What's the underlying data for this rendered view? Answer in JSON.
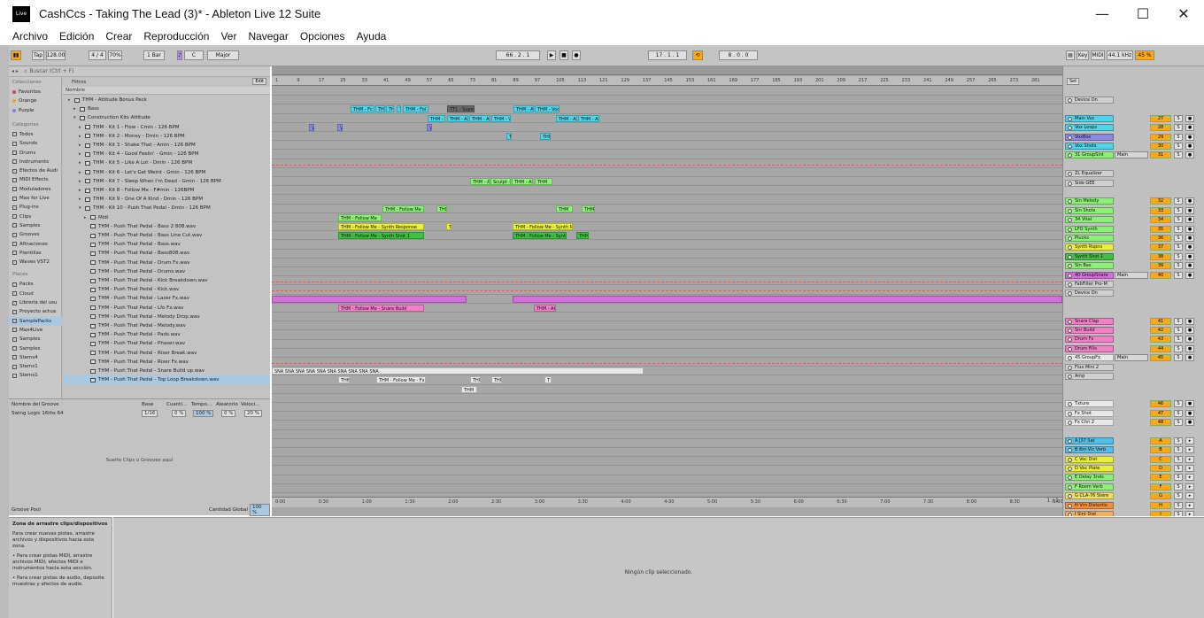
{
  "window": {
    "title": "CashCcs - Taking The Lead (3)* - Ableton Live 12 Suite",
    "logo": "Live",
    "controls": [
      "—",
      "☐",
      "✕"
    ]
  },
  "menu": [
    "Archivo",
    "Edición",
    "Crear",
    "Reproducción",
    "Ver",
    "Navegar",
    "Opciones",
    "Ayuda"
  ],
  "control_bar": {
    "tap": "Tap",
    "tempo": "128.00",
    "time_sig": "4 / 4",
    "swing": "70%",
    "quant": "1 Bar",
    "key": "C",
    "scale": "Major",
    "position": "66 .  2 .  1",
    "loop_start": "17 .  1 .  1",
    "loop_len": "8 .  0 .  0",
    "set_label": "Set",
    "key_label": "Key",
    "midi_label": "MIDI",
    "sample_rate": "44.1 kHz",
    "cpu": "45 %"
  },
  "browser": {
    "search_placeholder": "Buscar (Ctrl + F)",
    "filters_label": "Filtros",
    "edit_label": "Edit",
    "name_col": "Nombre",
    "sidebar": {
      "collections_header": "Colecciones",
      "collections": [
        {
          "label": "Favoritos",
          "color": "#e04040"
        },
        {
          "label": "Orange",
          "color": "#f0a030"
        },
        {
          "label": "Purple",
          "color": "#a070e0"
        }
      ],
      "categories_header": "Categorías",
      "categories": [
        "Todos",
        "Sounds",
        "Drums",
        "Instruments",
        "Efectos de Audi",
        "MIDI Effects",
        "Moduladores",
        "Max for Live",
        "Plug-ins",
        "Clips",
        "Samples",
        "Grooves",
        "Afinaciones",
        "Plantillas",
        "Waves VST2"
      ],
      "places_header": "Places",
      "places": [
        "Packs",
        "Cloud",
        "Librería del usu",
        "Proyecto actua",
        "SamplePacks",
        "Max4Live",
        "Samples",
        "Samples",
        "Stems4",
        "Stems1",
        "Stems1"
      ],
      "active_place": "SamplePacks"
    },
    "files": [
      {
        "label": "THM - Attitude Bonus Pack",
        "indent": 1,
        "type": "folder"
      },
      {
        "label": "Bass",
        "indent": 2,
        "type": "folder"
      },
      {
        "label": "Construction Kits Attitude",
        "indent": 2,
        "type": "folder",
        "open": true
      },
      {
        "label": "THM - Kit 1 - Flow - Cmin - 126 BPM",
        "indent": 3,
        "type": "folder"
      },
      {
        "label": "THM - Kit 2 - Money - Dmin - 126 BPM",
        "indent": 3,
        "type": "folder"
      },
      {
        "label": "THM - Kit 3 - Shake That - Amin - 126 BPM",
        "indent": 3,
        "type": "folder"
      },
      {
        "label": "THM - Kit 4 - Good Feelin' - Gmin - 126 BPM",
        "indent": 3,
        "type": "folder"
      },
      {
        "label": "THM - Kit 5 - Like A Lot - Dmin - 126 BPM",
        "indent": 3,
        "type": "folder"
      },
      {
        "label": "THM - Kit 6 - Let's Get Weird - Gmin - 126 BPM",
        "indent": 3,
        "type": "folder"
      },
      {
        "label": "THM - Kit 7 - Sleep When I'm Dead - Gmin - 126 BPM",
        "indent": 3,
        "type": "folder"
      },
      {
        "label": "THM - Kit 8 - Follow Me - F#min - 126BPM",
        "indent": 3,
        "type": "folder"
      },
      {
        "label": "THM - Kit 9 - One Of A Kind - Dmin - 126 BPM",
        "indent": 3,
        "type": "folder"
      },
      {
        "label": "THM - Kit 10 - Push That Pedal - Dmin - 126 BPM",
        "indent": 3,
        "type": "folder",
        "open": true
      },
      {
        "label": "Midi",
        "indent": 4,
        "type": "folder"
      },
      {
        "label": "THM - Push That Pedal - Bass 2 808.wav",
        "indent": 4,
        "type": "file"
      },
      {
        "label": "THM - Push That Pedal - Bass Line Cut.wav",
        "indent": 4,
        "type": "file"
      },
      {
        "label": "THM - Push That Pedal - Bass.wav",
        "indent": 4,
        "type": "file"
      },
      {
        "label": "THM - Push That Pedal - Bass808.wav",
        "indent": 4,
        "type": "file"
      },
      {
        "label": "THM - Push That Pedal - Drum Fx.wav",
        "indent": 4,
        "type": "file"
      },
      {
        "label": "THM - Push That Pedal - Drums.wav",
        "indent": 4,
        "type": "file"
      },
      {
        "label": "THM - Push That Pedal - Kick Breakdown.wav",
        "indent": 4,
        "type": "file"
      },
      {
        "label": "THM - Push That Pedal - Kick.wav",
        "indent": 4,
        "type": "file"
      },
      {
        "label": "THM - Push That Pedal - Lazer Fx.wav",
        "indent": 4,
        "type": "file"
      },
      {
        "label": "THM - Push That Pedal - Lfo Fx.wav",
        "indent": 4,
        "type": "file"
      },
      {
        "label": "THM - Push That Pedal - Melody Drop.wav",
        "indent": 4,
        "type": "file"
      },
      {
        "label": "THM - Push That Pedal - Melody.wav",
        "indent": 4,
        "type": "file"
      },
      {
        "label": "THM - Push That Pedal - Pads.wav",
        "indent": 4,
        "type": "file"
      },
      {
        "label": "THM - Push That Pedal - Phaser.wav",
        "indent": 4,
        "type": "file"
      },
      {
        "label": "THM - Push That Pedal - Riser Break.wav",
        "indent": 4,
        "type": "file"
      },
      {
        "label": "THM - Push That Pedal - Riser Fx.wav",
        "indent": 4,
        "type": "file"
      },
      {
        "label": "THM - Push That Pedal - Snare Build up.wav",
        "indent": 4,
        "type": "file"
      },
      {
        "label": "THM - Push That Pedal - Top Loop Breakdown.wav",
        "indent": 4,
        "type": "file",
        "selected": true
      }
    ]
  },
  "groove_pool": {
    "headers": [
      "Nombre del Groove",
      "Base",
      "Cuanti...",
      "Tempo...",
      "Aleatorio",
      "Veloci..."
    ],
    "row": {
      "name": "Swing Logic 16ths 64",
      "base": "1/16",
      "quant": "0 %",
      "timing": "100 %",
      "random": "0 %",
      "velocity": "20 %"
    },
    "hint": "Suelte Clips o Grooves aquí",
    "footer_title": "Groove Pool",
    "footer_amount_label": "Cantidad Global",
    "footer_amount": "100 %"
  },
  "ruler_ticks": [
    "1",
    "9",
    "17",
    "25",
    "33",
    "41",
    "49",
    "57",
    "65",
    "73",
    "81",
    "89",
    "97",
    "105",
    "113",
    "121",
    "129",
    "137",
    "145",
    "153",
    "161",
    "169",
    "177",
    "185",
    "193",
    "201",
    "209",
    "217",
    "225",
    "233",
    "241",
    "249",
    "257",
    "265",
    "273",
    "281"
  ],
  "time_ticks": [
    "0:00",
    "0:30",
    "1:00",
    "1:30",
    "2:00",
    "2:30",
    "3:00",
    "3:30",
    "4:00",
    "4:30",
    "5:00",
    "5:30",
    "6:00",
    "6:30",
    "7:00",
    "7:30",
    "8:00",
    "8:30",
    "9:00"
  ],
  "page_indicator": "1 / 1",
  "clips": [
    {
      "lane": 2,
      "start": 89,
      "end": 116,
      "label": "THM - Fc",
      "color": "#4fd4e8"
    },
    {
      "lane": 2,
      "start": 117,
      "end": 128,
      "label": "THM - C",
      "color": "#4fd4e8"
    },
    {
      "lane": 2,
      "start": 129,
      "end": 138,
      "label": "THM",
      "color": "#4fd4e8"
    },
    {
      "lane": 2,
      "start": 141,
      "end": 146,
      "label": "TH",
      "color": "#4fd4e8"
    },
    {
      "lane": 2,
      "start": 148,
      "end": 177,
      "label": "THM - Fol",
      "color": "#4fd4e8"
    },
    {
      "lane": 2,
      "start": 198,
      "end": 229,
      "label": "TT1 - Supe",
      "color": "#6a6a6a"
    },
    {
      "lane": 2,
      "start": 273,
      "end": 296,
      "label": "THM - Ab",
      "color": "#4fd4e8"
    },
    {
      "lane": 2,
      "start": 297,
      "end": 325,
      "label": "THM - Vocal",
      "color": "#4fd4e8"
    },
    {
      "lane": 3,
      "start": 176,
      "end": 196,
      "label": "THM - Ab",
      "color": "#4fd4e8"
    },
    {
      "lane": 3,
      "start": 198,
      "end": 222,
      "label": "THM - Ab",
      "color": "#4fd4e8"
    },
    {
      "lane": 3,
      "start": 223,
      "end": 247,
      "label": "THM - Ab",
      "color": "#4fd4e8"
    },
    {
      "lane": 3,
      "start": 248,
      "end": 270,
      "label": "THM - Vocal",
      "color": "#4fd4e8"
    },
    {
      "lane": 3,
      "start": 321,
      "end": 345,
      "label": "THM - Ab",
      "color": "#4fd4e8"
    },
    {
      "lane": 3,
      "start": 346,
      "end": 370,
      "label": "THM - Ab",
      "color": "#4fd4e8"
    },
    {
      "lane": 4,
      "start": 42,
      "end": 48,
      "label": "VS",
      "color": "#8a8ae0"
    },
    {
      "lane": 4,
      "start": 74,
      "end": 80,
      "label": "VS",
      "color": "#8a8ae0"
    },
    {
      "lane": 4,
      "start": 175,
      "end": 181,
      "label": "VO",
      "color": "#8a8ae0"
    },
    {
      "lane": 5,
      "start": 265,
      "end": 271,
      "label": "TH",
      "color": "#4fd4e8"
    },
    {
      "lane": 5,
      "start": 303,
      "end": 315,
      "label": "THM",
      "color": "#4fd4e8"
    },
    {
      "lane": 10,
      "start": 224,
      "end": 246,
      "label": "THM - At",
      "color": "#8ef07a"
    },
    {
      "lane": 10,
      "start": 247,
      "end": 270,
      "label": "Sculpt - 1",
      "color": "#8ef07a"
    },
    {
      "lane": 10,
      "start": 271,
      "end": 295,
      "label": "THM - At",
      "color": "#8ef07a"
    },
    {
      "lane": 10,
      "start": 297,
      "end": 317,
      "label": "THM",
      "color": "#8ef07a"
    },
    {
      "lane": 13,
      "start": 125,
      "end": 172,
      "label": "THM - Follow Me",
      "color": "#8ef07a"
    },
    {
      "lane": 13,
      "start": 186,
      "end": 198,
      "label": "THM",
      "color": "#8ef07a"
    },
    {
      "lane": 13,
      "start": 321,
      "end": 340,
      "label": "THM",
      "color": "#8ef07a"
    },
    {
      "lane": 13,
      "start": 350,
      "end": 365,
      "label": "THM",
      "color": "#8ef07a"
    },
    {
      "lane": 14,
      "start": 75,
      "end": 124,
      "label": "THM - Follow Me",
      "color": "#8ef07a"
    },
    {
      "lane": 15,
      "start": 75,
      "end": 172,
      "label": "THM - Follow Me - Synth Response",
      "color": "#e8f03a"
    },
    {
      "lane": 15,
      "start": 197,
      "end": 203,
      "label": "TI",
      "color": "#e8f03a"
    },
    {
      "lane": 15,
      "start": 272,
      "end": 340,
      "label": "THM - Follow Me - Synth R",
      "color": "#e8f03a"
    },
    {
      "lane": 16,
      "start": 75,
      "end": 172,
      "label": "THM - Follow Me - Synth Shot 1",
      "color": "#40c040"
    },
    {
      "lane": 16,
      "start": 272,
      "end": 333,
      "label": "THM - Follow Me - Synth",
      "color": "#40c040"
    },
    {
      "lane": 16,
      "start": 344,
      "end": 358,
      "label": "THM",
      "color": "#40c040"
    },
    {
      "lane": 23,
      "start": 0,
      "end": 220,
      "label": "",
      "color": "#d070d8"
    },
    {
      "lane": 23,
      "start": 272,
      "end": 893,
      "label": "",
      "color": "#d070d8"
    },
    {
      "lane": 24,
      "start": 75,
      "end": 172,
      "label": "THM - Follow Me - Snare Build",
      "color": "#f080c8"
    },
    {
      "lane": 24,
      "start": 296,
      "end": 321,
      "label": "THM - Ar",
      "color": "#f080c8"
    },
    {
      "lane": 31,
      "start": 0,
      "end": 420,
      "label": "SNA SNA SNA SNA SNA SNA SNA SNA SNA SNA",
      "color": "#e8e8e8"
    },
    {
      "lane": 32,
      "start": 75,
      "end": 88,
      "label": "THM",
      "color": "#e8e8e8"
    },
    {
      "lane": 32,
      "start": 118,
      "end": 174,
      "label": "THM - Follow Me - Fx",
      "color": "#e8e8e8"
    },
    {
      "lane": 32,
      "start": 224,
      "end": 236,
      "label": "THM",
      "color": "#e8e8e8"
    },
    {
      "lane": 32,
      "start": 248,
      "end": 260,
      "label": "THM",
      "color": "#e8e8e8"
    },
    {
      "lane": 32,
      "start": 308,
      "end": 316,
      "label": "T",
      "color": "#e8e8e8"
    },
    {
      "lane": 33,
      "start": 214,
      "end": 232,
      "label": "THM",
      "color": "#e8e8e8"
    }
  ],
  "mixer_tracks": [
    {
      "row": 0,
      "name": "Device On",
      "color": "#d0d0d0",
      "num": "",
      "kind": "device"
    },
    {
      "row": 2,
      "name": "Main Voc",
      "color": "#4fd4e8",
      "num": "27"
    },
    {
      "row": 3,
      "name": "Vox Loops",
      "color": "#4fd4e8",
      "num": "28"
    },
    {
      "row": 4,
      "name": "VoxBox",
      "color": "#8a8ae0",
      "num": "29"
    },
    {
      "row": 5,
      "name": "Vox Shots",
      "color": "#4fd4e8",
      "num": "30"
    },
    {
      "row": 6,
      "name": "31 GroupSint",
      "color": "#8ef07a",
      "num": "31",
      "group": true,
      "out": "Main"
    },
    {
      "row": 8,
      "name": "ZL Equalizer",
      "color": "#d0d0d0",
      "num": "",
      "kind": "device"
    },
    {
      "row": 9,
      "name": "Side GEE",
      "color": "#d0d0d0",
      "num": "",
      "kind": "device"
    },
    {
      "row": 11,
      "name": "Sin Melody",
      "color": "#8ef07a",
      "num": "32"
    },
    {
      "row": 12,
      "name": "Sin Shots",
      "color": "#8ef07a",
      "num": "33"
    },
    {
      "row": 13,
      "name": "34 Vital",
      "color": "#8ef07a",
      "num": "34"
    },
    {
      "row": 14,
      "name": "LFO Synth",
      "color": "#8ef07a",
      "num": "35"
    },
    {
      "row": 15,
      "name": "Plucks",
      "color": "#8ef07a",
      "num": "36"
    },
    {
      "row": 16,
      "name": "Synth Rspns",
      "color": "#e8f03a",
      "num": "37"
    },
    {
      "row": 17,
      "name": "Synth Shot 1",
      "color": "#40c040",
      "num": "38"
    },
    {
      "row": 18,
      "name": "Sin Bas",
      "color": "#8ef07a",
      "num": "39"
    },
    {
      "row": 19,
      "name": "40 GroupSnare",
      "color": "#d070d8",
      "num": "40",
      "group": true,
      "out": "Main"
    },
    {
      "row": 20,
      "name": "FabFilter Pro-M",
      "color": "#d0d0d0",
      "num": "",
      "kind": "device"
    },
    {
      "row": 21,
      "name": "Device On",
      "color": "#d0d0d0",
      "num": "",
      "kind": "device"
    },
    {
      "row": 24,
      "name": "Snare Clap",
      "color": "#f080c8",
      "num": "41"
    },
    {
      "row": 25,
      "name": "Snr Build",
      "color": "#f080c8",
      "num": "42"
    },
    {
      "row": 26,
      "name": "Drum Fx",
      "color": "#f080c8",
      "num": "43"
    },
    {
      "row": 27,
      "name": "Drum Fills",
      "color": "#f080c8",
      "num": "44"
    },
    {
      "row": 28,
      "name": "45 GroupFx",
      "color": "#e8e8e8",
      "num": "45",
      "group": true,
      "out": "Main"
    },
    {
      "row": 29,
      "name": "Flux Mini 2",
      "color": "#d0d0d0",
      "num": "",
      "kind": "device"
    },
    {
      "row": 30,
      "name": "Amp",
      "color": "#d0d0d0",
      "num": "",
      "kind": "device"
    },
    {
      "row": 33,
      "name": "Txture",
      "color": "#e8e8e8",
      "num": "46"
    },
    {
      "row": 34,
      "name": "Fx Shot",
      "color": "#e8e8e8",
      "num": "47"
    },
    {
      "row": 35,
      "name": "Fx Chn 2",
      "color": "#e8e8e8",
      "num": "48"
    },
    {
      "row": 37,
      "name": "A J37 Sat",
      "color": "#4fc0e8",
      "num": "A",
      "ret": true
    },
    {
      "row": 38,
      "name": "B 8m Vlc Verb",
      "color": "#4fc0e8",
      "num": "B",
      "ret": true
    },
    {
      "row": 39,
      "name": "C Voc Dist",
      "color": "#e8f03a",
      "num": "C",
      "ret": true
    },
    {
      "row": 40,
      "name": "D Voc Plate",
      "color": "#e8f03a",
      "num": "D",
      "ret": true
    },
    {
      "row": 41,
      "name": "E Delay 3nds",
      "color": "#8ef07a",
      "num": "E",
      "ret": true
    },
    {
      "row": 42,
      "name": "F Room Verb",
      "color": "#8ef07a",
      "num": "F",
      "ret": true
    },
    {
      "row": 43,
      "name": "G CLA-76 Stere",
      "color": "#f0e060",
      "num": "G",
      "ret": true
    },
    {
      "row": 44,
      "name": "H Vrn Distortio",
      "color": "#f09040",
      "num": "H",
      "ret": true
    },
    {
      "row": 45,
      "name": "I Sint Dist",
      "color": "#f0b060",
      "num": "I",
      "ret": true
    },
    {
      "row": 46,
      "name": "Main",
      "color": "#a0c8f0",
      "num": "0",
      "ret": true,
      "out": "1/2"
    }
  ],
  "info": {
    "title": "Zona de arrastre clips/dispositivos",
    "p1": "Para crear nuevas pistas, arrastre archivos y dispositivos hacia esta zona.",
    "p2": "• Para crear pistas MIDI, arrastre archivos MIDI, efectos MIDI e instrumentos hacia esta sección.",
    "p3": "• Para crear pistas de audio, deposite muestras y efectos de audio."
  },
  "detail": {
    "no_clip": "Ningún clip seleccionado."
  },
  "colors": {
    "ableton_orange": "#f7a81b",
    "selection_blue": "#a9c9e3",
    "arrangement_bg": "#a7a7a7"
  }
}
